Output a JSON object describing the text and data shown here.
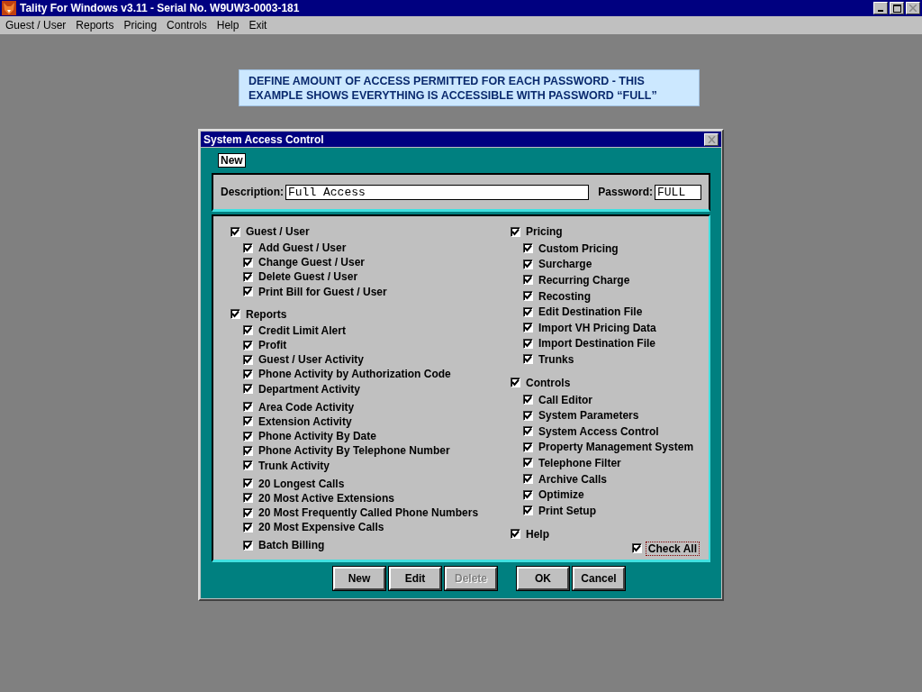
{
  "app": {
    "title": "Tality For Windows v3.11 - Serial No. W9UW3-0003-181"
  },
  "menu": [
    "Guest / User",
    "Reports",
    "Pricing",
    "Controls",
    "Help",
    "Exit"
  ],
  "banner": "DEFINE AMOUNT OF ACCESS PERMITTED FOR EACH PASSWORD - THIS EXAMPLE SHOWS EVERYTHING IS ACCESSIBLE WITH PASSWORD “FULL”",
  "dialog": {
    "title": "System Access Control",
    "mode": "New",
    "description_label": "Description:",
    "description": "Full Access",
    "password_label": "Password:",
    "password": "FULL",
    "columns": [
      {
        "groups": [
          {
            "label": "Guest / User",
            "checked": true,
            "sections": [
              [
                {
                  "label": "Add Guest / User",
                  "checked": true
                },
                {
                  "label": "Change Guest / User",
                  "checked": true
                },
                {
                  "label": "Delete Guest / User",
                  "checked": true
                },
                {
                  "label": "Print Bill for Guest / User",
                  "checked": true
                }
              ]
            ]
          },
          {
            "label": "Reports",
            "checked": true,
            "sections": [
              [
                {
                  "label": "Credit Limit Alert",
                  "checked": true
                },
                {
                  "label": "Profit",
                  "checked": true
                },
                {
                  "label": "Guest / User Activity",
                  "checked": true
                },
                {
                  "label": "Phone Activity by Authorization Code",
                  "checked": true
                },
                {
                  "label": "Department Activity",
                  "checked": true
                }
              ],
              [
                {
                  "label": "Area Code Activity",
                  "checked": true
                },
                {
                  "label": "Extension Activity",
                  "checked": true
                },
                {
                  "label": "Phone Activity By Date",
                  "checked": true
                },
                {
                  "label": "Phone Activity By Telephone Number",
                  "checked": true
                },
                {
                  "label": "Trunk Activity",
                  "checked": true
                }
              ],
              [
                {
                  "label": "20 Longest Calls",
                  "checked": true
                },
                {
                  "label": "20 Most Active Extensions",
                  "checked": true
                },
                {
                  "label": "20 Most Frequently Called Phone Numbers",
                  "checked": true
                },
                {
                  "label": "20 Most Expensive Calls",
                  "checked": true
                }
              ],
              [
                {
                  "label": "Batch Billing",
                  "checked": true
                }
              ]
            ]
          }
        ]
      },
      {
        "groups": [
          {
            "label": "Pricing",
            "checked": true,
            "sections": [
              [
                {
                  "label": "Custom Pricing",
                  "checked": true
                },
                {
                  "label": "Surcharge",
                  "checked": true
                },
                {
                  "label": "Recurring Charge",
                  "checked": true
                },
                {
                  "label": "Recosting",
                  "checked": true
                },
                {
                  "label": "Edit Destination File",
                  "checked": true
                },
                {
                  "label": "Import VH Pricing Data",
                  "checked": true
                },
                {
                  "label": "Import Destination File",
                  "checked": true
                },
                {
                  "label": "Trunks",
                  "checked": true
                }
              ]
            ]
          },
          {
            "label": "Controls",
            "checked": true,
            "sections": [
              [
                {
                  "label": "Call Editor",
                  "checked": true
                },
                {
                  "label": "System Parameters",
                  "checked": true
                },
                {
                  "label": "System Access Control",
                  "checked": true
                },
                {
                  "label": "Property Management System",
                  "checked": true
                },
                {
                  "label": "Telephone Filter",
                  "checked": true
                },
                {
                  "label": "Archive Calls",
                  "checked": true
                },
                {
                  "label": "Optimize",
                  "checked": true
                },
                {
                  "label": "Print Setup",
                  "checked": true
                }
              ]
            ]
          },
          {
            "label": "Help",
            "checked": true
          }
        ]
      }
    ],
    "check_all": {
      "label": "Check All",
      "checked": true
    },
    "button_groups": [
      [
        {
          "label": "New",
          "disabled": false
        },
        {
          "label": "Edit",
          "disabled": false
        },
        {
          "label": "Delete",
          "disabled": true
        }
      ],
      [
        {
          "label": "OK",
          "disabled": false
        },
        {
          "label": "Cancel",
          "disabled": false
        }
      ]
    ]
  }
}
